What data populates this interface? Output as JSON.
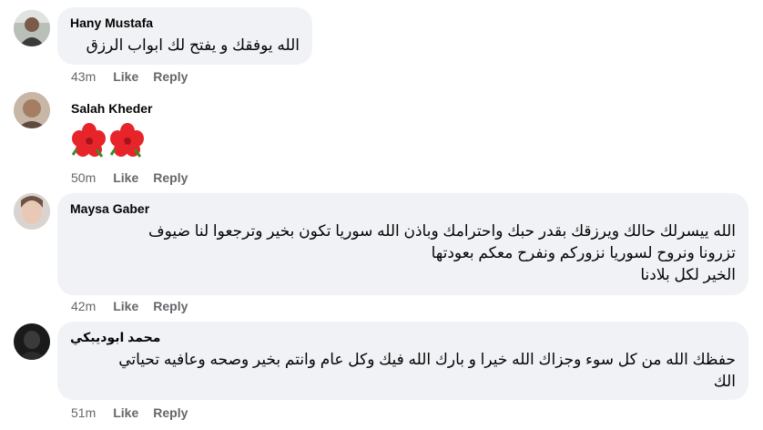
{
  "comments": [
    {
      "author": "Hany Mustafa",
      "text": "الله يوفقك و يفتح لك ابواب الرزق",
      "time": "43m",
      "like": "Like",
      "reply": "Reply"
    },
    {
      "author": "Salah Kheder",
      "emoji": "hibiscus-flower-icon",
      "time": "50m",
      "like": "Like",
      "reply": "Reply"
    },
    {
      "author": "Maysa Gaber",
      "text": "الله ييسرلك حالك ويرزقك بقدر حبك واحترامك وباذن الله سوريا تكون بخير وترجعوا لنا ضيوف\nتزرونا ونروح لسوريا نزوركم ونفرح معكم بعودتها\nالخير لكل بلادنا",
      "time": "42m",
      "like": "Like",
      "reply": "Reply"
    },
    {
      "author": "محمد ابوديبكي",
      "text": "حفظك الله من كل سوء وجزاك الله خيرا و بارك الله فيك وكل عام وانتم بخير وصحه وعافيه تحياتي\nالك",
      "time": "51m",
      "like": "Like",
      "reply": "Reply"
    }
  ],
  "colors": {
    "bubble": "#f0f2f5",
    "meta": "#65676b",
    "flower": "#e8242b"
  }
}
